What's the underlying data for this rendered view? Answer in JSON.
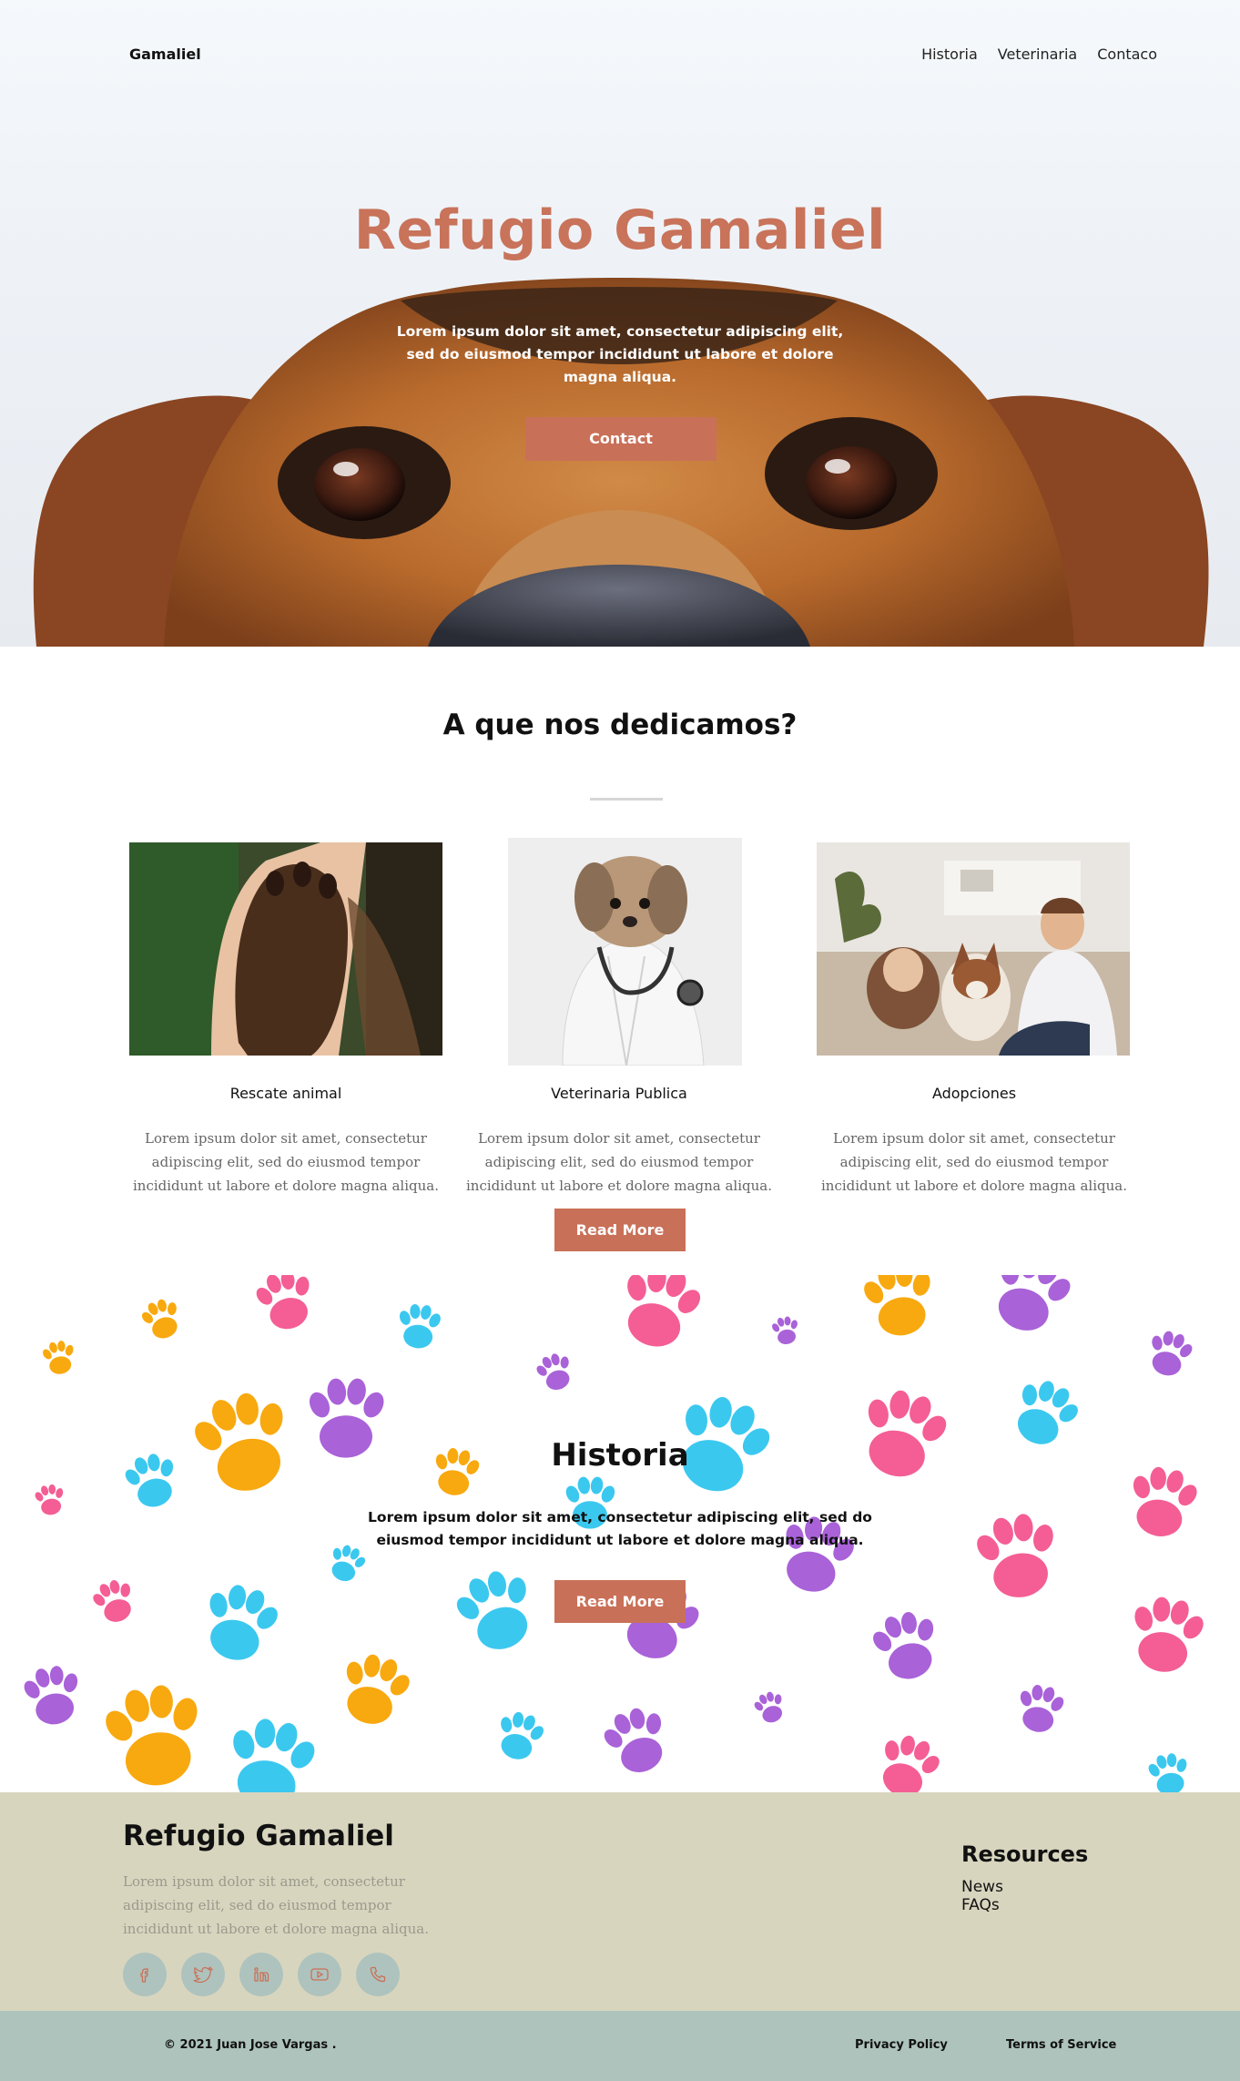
{
  "nav": {
    "brand": "Gamaliel",
    "links": [
      "Historia",
      "Veterinaria",
      "Contaco"
    ]
  },
  "hero": {
    "title": "Refugio Gamaliel",
    "text": "Lorem ipsum dolor sit amet, consectetur adipiscing elit, sed do eiusmod tempor incididunt ut labore et dolore magna aliqua.",
    "button": "Contact"
  },
  "services": {
    "title": "A que nos dedicamos?",
    "cards": [
      {
        "title": "Rescate animal",
        "text": "Lorem ipsum dolor sit amet, consectetur adipiscing elit, sed do eiusmod tempor incididunt ut labore et dolore magna aliqua."
      },
      {
        "title": "Veterinaria Publica",
        "text": "Lorem ipsum dolor sit amet, consectetur adipiscing elit, sed do eiusmod tempor incididunt ut labore et dolore magna aliqua."
      },
      {
        "title": "Adopciones",
        "text": "Lorem ipsum dolor sit amet, consectetur adipiscing elit, sed do eiusmod tempor incididunt ut labore et dolore magna aliqua."
      }
    ],
    "button": "Read More"
  },
  "historia": {
    "title": "Historia",
    "text": "Lorem ipsum dolor sit amet, consectetur adipiscing elit, sed do eiusmod tempor incididunt ut labore et dolore magna aliqua.",
    "button": "Read More"
  },
  "footer": {
    "title": "Refugio Gamaliel",
    "text": "Lorem ipsum dolor sit amet, consectetur adipiscing elit, sed do eiusmod tempor incididunt ut labore et dolore magna aliqua.",
    "socials": [
      "facebook-icon",
      "twitter-icon",
      "linkedin-icon",
      "youtube-icon",
      "phone-icon"
    ],
    "resources_title": "Resources",
    "resources": [
      "News",
      "FAQs"
    ],
    "copyright": "© 2021 Juan Jose Vargas .",
    "privacy": "Privacy Policy",
    "terms": "Terms of Service"
  },
  "colors": {
    "accent": "#c97058",
    "footer_bg": "#d8d5bf",
    "bottom_bg": "#adc3bc",
    "social_bg": "#aec3bd",
    "paw_pink": "#f45e95",
    "paw_blue": "#3bc8ef",
    "paw_orange": "#f8a90f",
    "paw_purple": "#a962d8"
  }
}
